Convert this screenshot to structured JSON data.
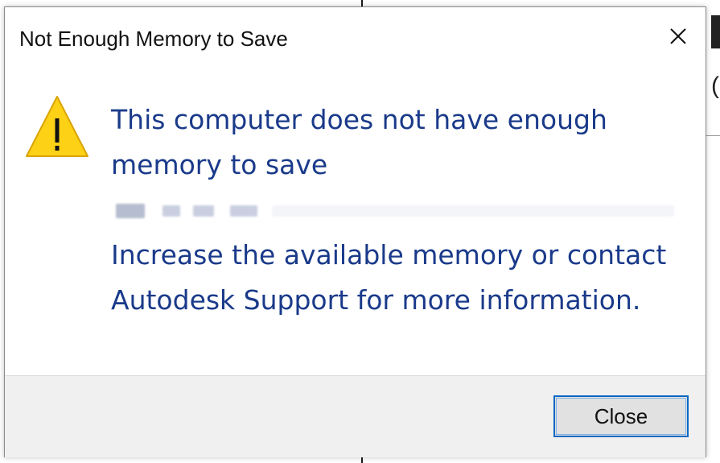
{
  "dialog": {
    "title": "Not Enough Memory to Save",
    "close_icon": "close-icon",
    "warning_icon": "warning-icon",
    "warning_color": "#fcd116",
    "message_color": "#1a3a8a",
    "message_lines": [
      "This computer does not have enough",
      "memory to save",
      "Increase the available memory or contact",
      "Autodesk Support for more information."
    ],
    "close_button_label": "Close",
    "accent_color": "#0a68c2"
  }
}
